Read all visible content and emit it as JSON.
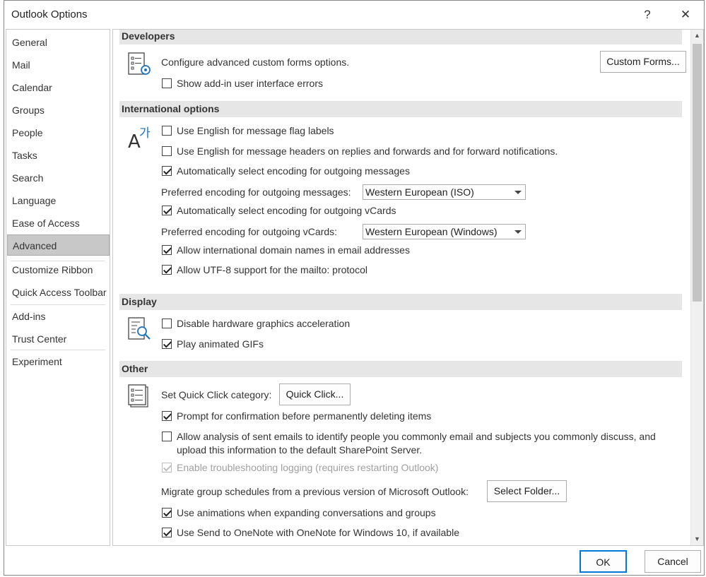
{
  "window": {
    "title": "Outlook Options",
    "help_label": "?",
    "close_label": "✕"
  },
  "nav": {
    "items": [
      "General",
      "Mail",
      "Calendar",
      "Groups",
      "People",
      "Tasks",
      "Search",
      "Language",
      "Ease of Access",
      "Advanced",
      "Customize Ribbon",
      "Quick Access Toolbar",
      "Add-ins",
      "Trust Center",
      "Experiment"
    ],
    "selected": "Advanced"
  },
  "sections": {
    "developers": {
      "title": "Developers",
      "configure_text": "Configure advanced custom forms options.",
      "custom_forms_button": "Custom Forms...",
      "show_addin_errors": {
        "label": "Show add-in user interface errors",
        "checked": false
      }
    },
    "international": {
      "title": "International options",
      "english_flag": {
        "label": "Use English for message flag labels",
        "checked": false
      },
      "english_headers": {
        "label": "Use English for message headers on replies and forwards and for forward notifications.",
        "checked": false
      },
      "auto_encoding_messages": {
        "label": "Automatically select encoding for outgoing messages",
        "checked": true
      },
      "pref_encoding_messages_label": "Preferred encoding for outgoing messages:",
      "pref_encoding_messages_value": "Western European (ISO)",
      "auto_encoding_vcards": {
        "label": "Automatically select encoding for outgoing vCards",
        "checked": true
      },
      "pref_encoding_vcards_label": "Preferred encoding for outgoing vCards:",
      "pref_encoding_vcards_value": "Western European (Windows)",
      "intl_domain": {
        "label": "Allow international domain names in email addresses",
        "checked": true
      },
      "utf8_mailto": {
        "label": "Allow UTF-8 support for the mailto: protocol",
        "checked": true
      }
    },
    "display": {
      "title": "Display",
      "disable_hw_accel": {
        "label": "Disable hardware graphics acceleration",
        "checked": false
      },
      "play_gifs": {
        "label": "Play animated GIFs",
        "checked": true
      }
    },
    "other": {
      "title": "Other",
      "quick_click_label": "Set Quick Click category:",
      "quick_click_button": "Quick Click...",
      "prompt_delete": {
        "label": "Prompt for confirmation before permanently deleting items",
        "checked": true
      },
      "allow_analysis_line1": "Allow analysis of sent emails to identify people you commonly email and subjects you commonly discuss, and",
      "allow_analysis_line2": "upload this information to the default SharePoint Server.",
      "allow_analysis_checked": false,
      "troubleshoot_logging": {
        "label": "Enable troubleshooting logging (requires restarting Outlook)",
        "checked": true,
        "disabled": true
      },
      "migrate_label": "Migrate group schedules from a previous version of Microsoft Outlook:",
      "select_folder_button": "Select Folder...",
      "use_animations": {
        "label": "Use animations when expanding conversations and groups",
        "checked": true
      },
      "send_onenote": {
        "label": "Use Send to OneNote with OneNote for Windows 10, if available",
        "checked": true
      }
    }
  },
  "footer": {
    "ok": "OK",
    "cancel": "Cancel"
  },
  "icons": {
    "scroll_up": "▲",
    "scroll_down": "▼"
  },
  "colors": {
    "section_bg": "#e6e6e6",
    "nav_selected_bg": "#c8c8c8",
    "ok_border": "#0078d7",
    "icon_blue": "#1e73be"
  }
}
